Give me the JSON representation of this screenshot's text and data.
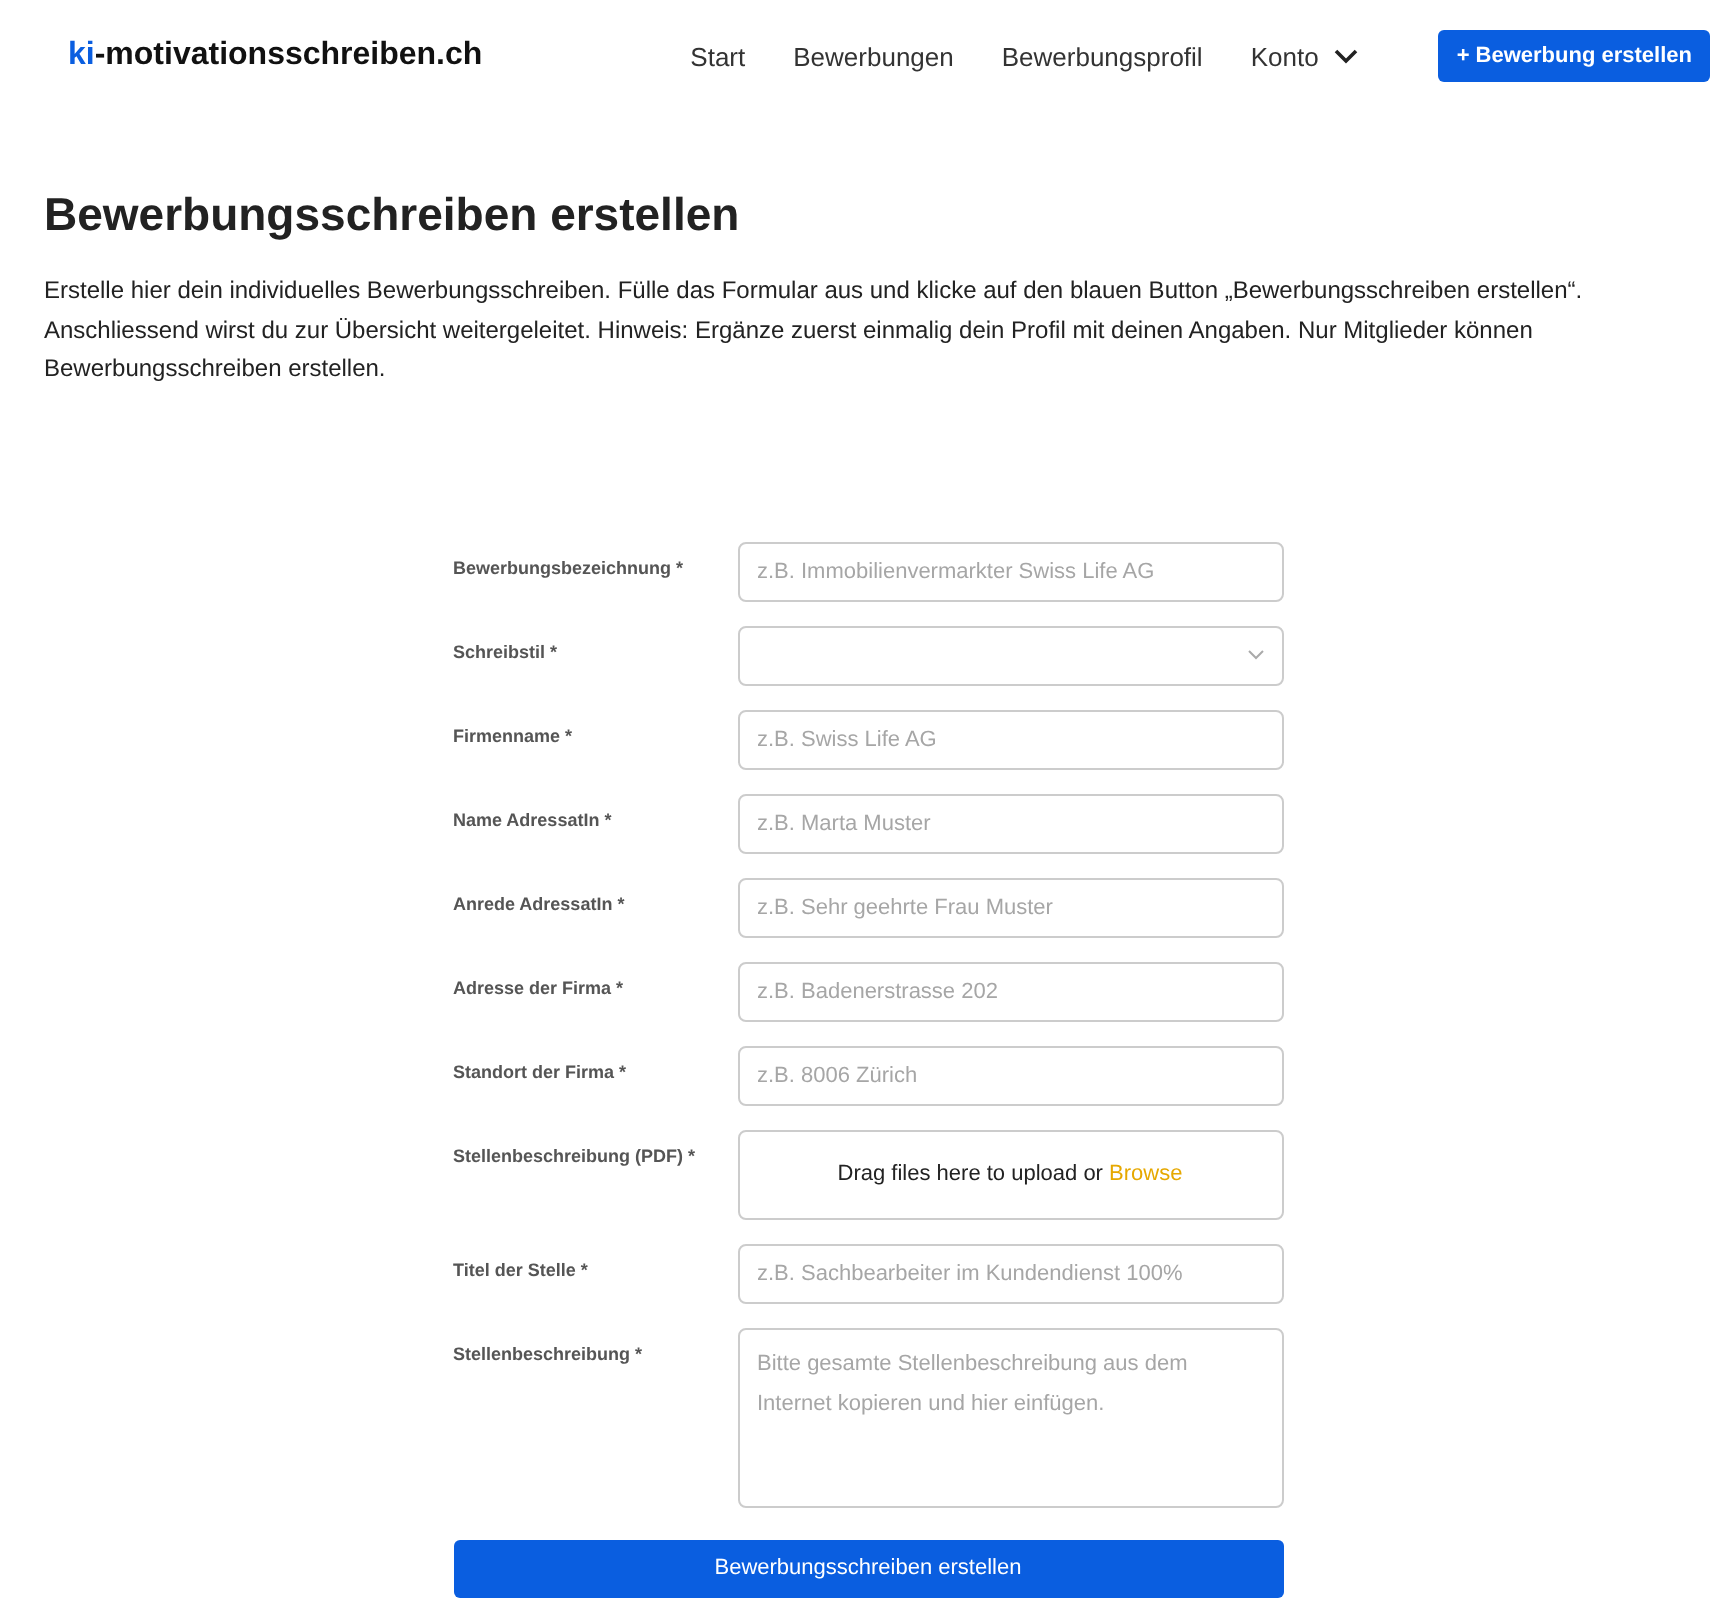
{
  "header": {
    "logo_accent": "ki",
    "logo_rest": "-motivationsschreiben.ch",
    "nav": [
      {
        "label": "Start",
        "kind": "link"
      },
      {
        "label": "Bewerbungen",
        "kind": "link"
      },
      {
        "label": "Bewerbungsprofil",
        "kind": "link"
      },
      {
        "label": "Konto",
        "kind": "dropdown"
      }
    ],
    "cta": "+ Bewerbung erstellen"
  },
  "title": "Bewerbungsschreiben erstellen",
  "intro": "Erstelle hier dein individuelles Bewerbungsschreiben. Fülle das Formular aus und klicke auf den blauen Button „Bewerbungsschreiben erstellen“. Anschliessend wirst du zur Übersicht weitergeleitet. Hinweis: Ergänze zuerst einmalig dein Profil mit deinen Angaben. Nur Mitglieder können Bewerbungsschreiben erstellen.",
  "form": {
    "fields": [
      {
        "label": "Bewerbungsbezeichnung *",
        "kind": "text",
        "placeholder": "z.B. Immobilienvermarkter Swiss Life AG"
      },
      {
        "label": "Schreibstil *",
        "kind": "select"
      },
      {
        "label": "Firmenname *",
        "kind": "text",
        "placeholder": "z.B. Swiss Life AG"
      },
      {
        "label": "Name AdressatIn *",
        "kind": "text",
        "placeholder": "z.B. Marta Muster"
      },
      {
        "label": "Anrede AdressatIn *",
        "kind": "text",
        "placeholder": "z.B. Sehr geehrte Frau Muster"
      },
      {
        "label": "Adresse der Firma *",
        "kind": "text",
        "placeholder": "z.B. Badenerstrasse 202"
      },
      {
        "label": "Standort der Firma *",
        "kind": "text",
        "placeholder": "z.B. 8006 Zürich"
      },
      {
        "label": "Stellenbeschreibung (PDF) *",
        "kind": "upload",
        "text": "Drag files here to upload or",
        "link": "Browse"
      },
      {
        "label": "Titel der Stelle *",
        "kind": "text",
        "placeholder": "z.B. Sachbearbeiter im Kundendienst 100%"
      },
      {
        "label": "Stellenbeschreibung *",
        "kind": "textarea",
        "placeholder": "Bitte gesamte Stellenbeschreibung aus dem Internet kopieren und hier einfügen."
      }
    ],
    "submit": "Bewerbungsschreiben erstellen"
  }
}
